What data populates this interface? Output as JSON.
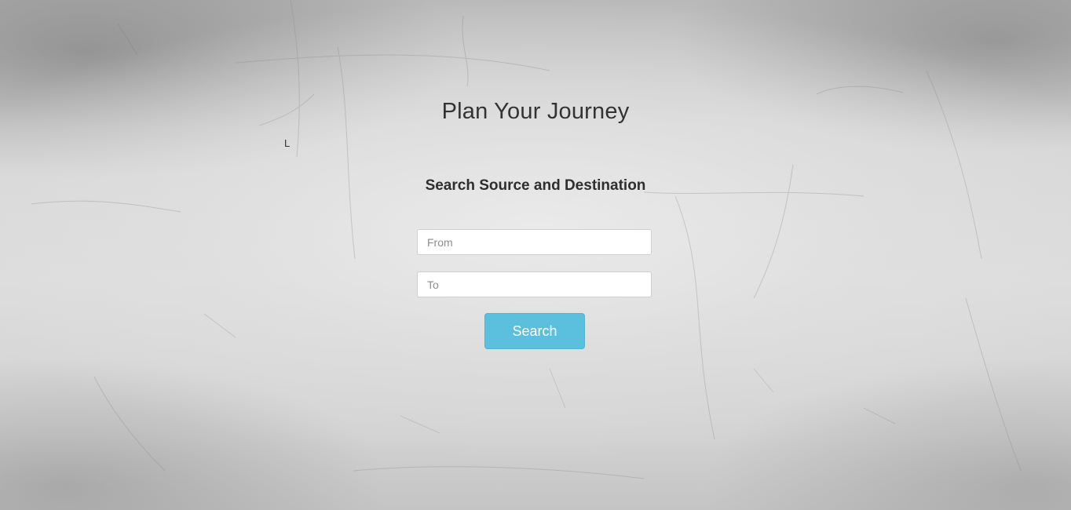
{
  "page": {
    "title": "Plan Your Journey",
    "stray_text": "L",
    "subtitle": "Search Source and Destination"
  },
  "form": {
    "from": {
      "value": "",
      "placeholder": "From"
    },
    "to": {
      "value": "",
      "placeholder": "To"
    },
    "search_label": "Search"
  },
  "colors": {
    "button_bg": "#5bc0de",
    "button_text": "#ffffff",
    "title_text": "#333333",
    "background": "#d6d6d6"
  }
}
